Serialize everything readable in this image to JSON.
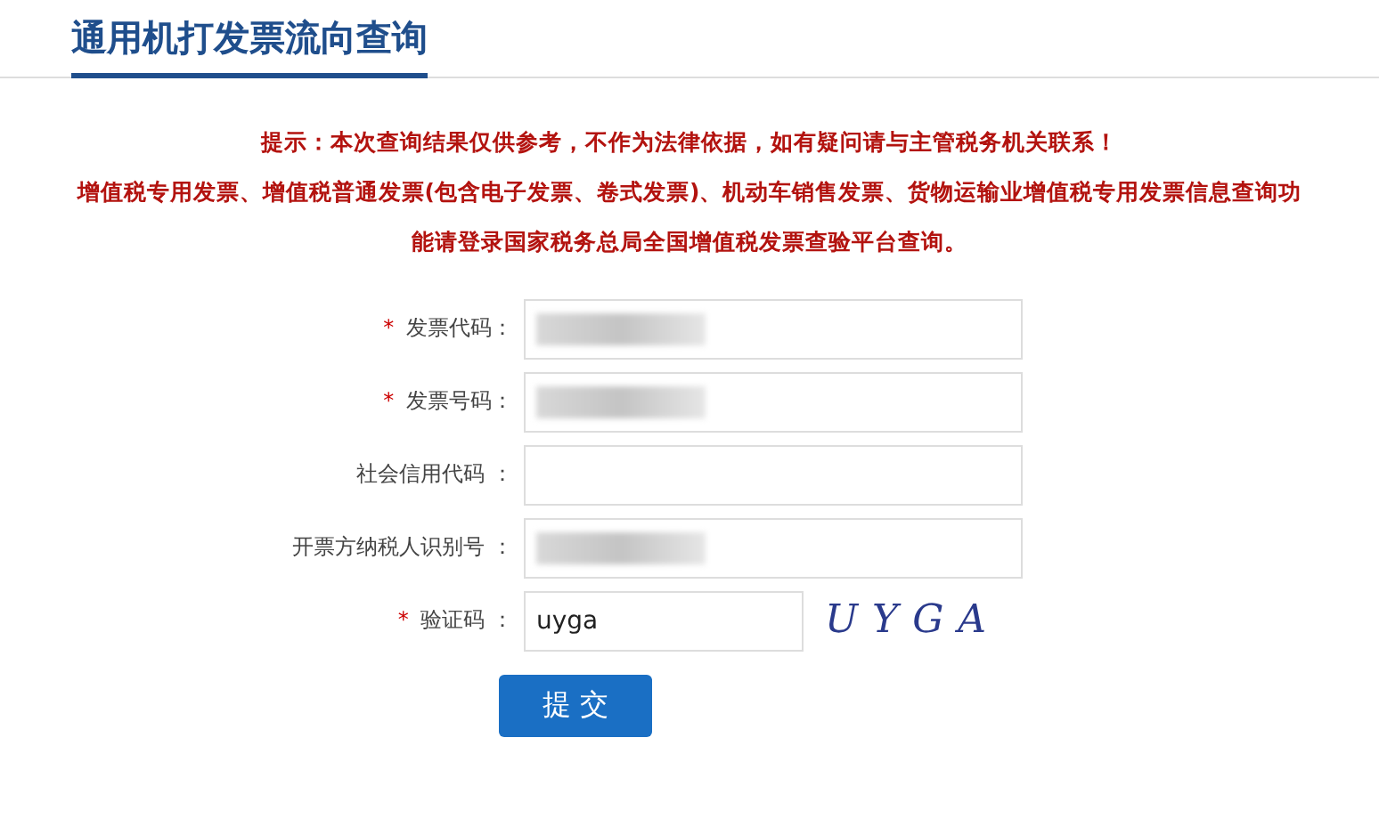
{
  "title": "通用机打发票流向查询",
  "notice": {
    "tip": "提示：本次查询结果仅供参考，不作为法律依据，如有疑问请与主管税务机关联系！",
    "info": "增值税专用发票、增值税普通发票(包含电子发票、卷式发票)、机动车销售发票、货物运输业增值税专用发票信息查询功能请登录国家税务总局全国增值税发票查验平台查询。"
  },
  "fields": [
    {
      "kind": "text",
      "label": "发票代码：",
      "required": true,
      "redacted": true
    },
    {
      "kind": "text",
      "label": "发票号码：",
      "required": true,
      "redacted": true
    },
    {
      "kind": "text",
      "label": "社会信用代码 ：",
      "required": false,
      "redacted": false
    },
    {
      "kind": "text",
      "label": "开票方纳税人识别号 ：",
      "required": false,
      "redacted": true
    },
    {
      "kind": "captcha",
      "label": "验证码 ：",
      "required": true,
      "redacted": false,
      "value": "uyga",
      "captcha": "UYGA"
    }
  ],
  "required_mark": "*",
  "submit": "提 交"
}
